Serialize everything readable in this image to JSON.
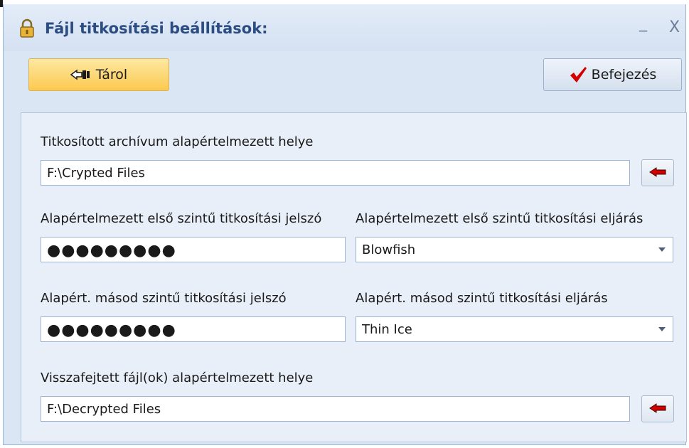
{
  "window": {
    "title": "Fájl titkosítási beállítások:",
    "minimize_glyph": "_",
    "close_glyph": "X"
  },
  "toolbar": {
    "store_label": "Tárol",
    "store_icon": "pointing-hand-icon",
    "finish_label": "Befejezés",
    "finish_icon": "checkmark-icon"
  },
  "form": {
    "archive_location": {
      "label": "Titkosított archívum alapértelmezett helye",
      "value": "F:\\Crypted Files",
      "browse_icon": "red-arrow-left-icon"
    },
    "first_password": {
      "label": "Alapértelmezett első szintű titkosítási jelszó",
      "value": "●●●●●●●●●"
    },
    "first_method": {
      "label": "Alapértelmezett első szintű titkosítási eljárás",
      "value": "Blowfish"
    },
    "second_password": {
      "label": "Alapért. másod szintű titkosítási jelszó",
      "value": "●●●●●●●●●"
    },
    "second_method": {
      "label": "Alapért. másod szintű titkosítási eljárás",
      "value": "Thin Ice"
    },
    "decrypted_location": {
      "label": "Visszafejtett fájl(ok) alapértelmezett helye",
      "value": "F:\\Decrypted Files",
      "browse_icon": "red-arrow-left-icon"
    }
  },
  "colors": {
    "title_text": "#2c4d82",
    "store_button": "#fcc94f",
    "checkmark": "#d40000",
    "arrow": "#d40000"
  }
}
